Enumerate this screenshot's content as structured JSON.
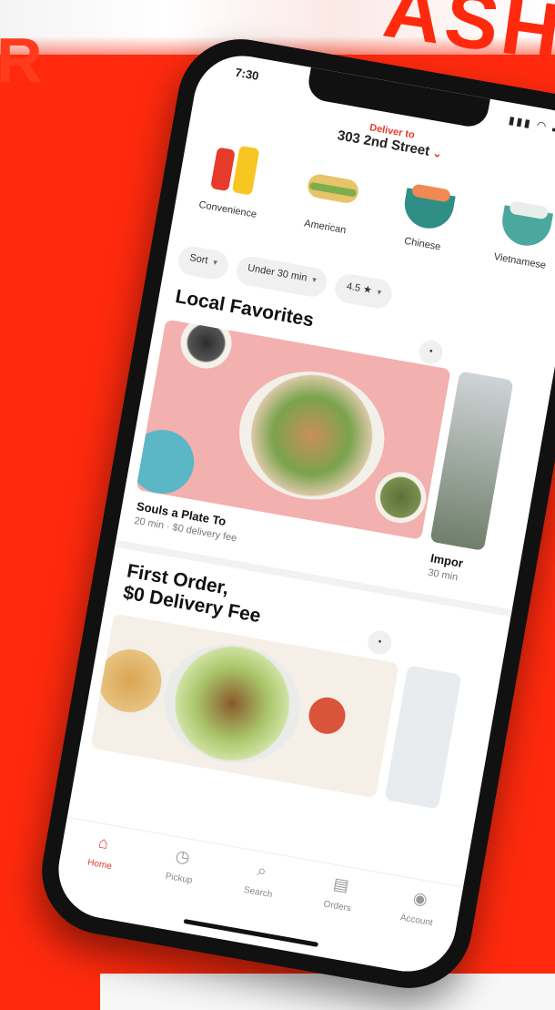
{
  "background": {
    "banner_text_right": "ASH",
    "banner_text_left": "R",
    "brand_red": "#ff2a0e"
  },
  "status_bar": {
    "time": "7:30",
    "icons": "▮▮▮ ◠ ▬"
  },
  "header": {
    "address_label": "Deliver to",
    "address": "303 2nd Street",
    "chevron": "⌄"
  },
  "categories": [
    {
      "label": "Convenience",
      "icon": "drinks-icon"
    },
    {
      "label": "American",
      "icon": "sandwich-icon"
    },
    {
      "label": "Chinese",
      "icon": "bowl-icon"
    },
    {
      "label": "Vietnamese",
      "icon": "pho-bowl-icon"
    }
  ],
  "filters": [
    {
      "label": "Sort",
      "dropdown": "▾"
    },
    {
      "label": "Under 30 min",
      "dropdown": "▾"
    },
    {
      "label": "4.5 ★",
      "dropdown": "▾"
    }
  ],
  "local_favorites": {
    "title": "Local Favorites",
    "save_icon": "•",
    "card": {
      "title": "Souls a Plate To",
      "subtitle": "20 min · $0 delivery fee"
    },
    "side_card": {
      "title": "Impor",
      "subtitle": "30 min"
    }
  },
  "promo": {
    "title_line1": "First Order,",
    "title_line2": "$0 Delivery Fee",
    "save_icon": "•"
  },
  "tabbar": [
    {
      "label": "Home",
      "icon": "⌂",
      "active": true
    },
    {
      "label": "Pickup",
      "icon": "◷",
      "active": false
    },
    {
      "label": "Search",
      "icon": "⌕",
      "active": false
    },
    {
      "label": "Orders",
      "icon": "▤",
      "active": false
    },
    {
      "label": "Account",
      "icon": "◉",
      "active": false
    }
  ],
  "colors": {
    "accent": "#e6392a",
    "text_dark": "#111111",
    "chip_bg": "#f0f0f0"
  }
}
